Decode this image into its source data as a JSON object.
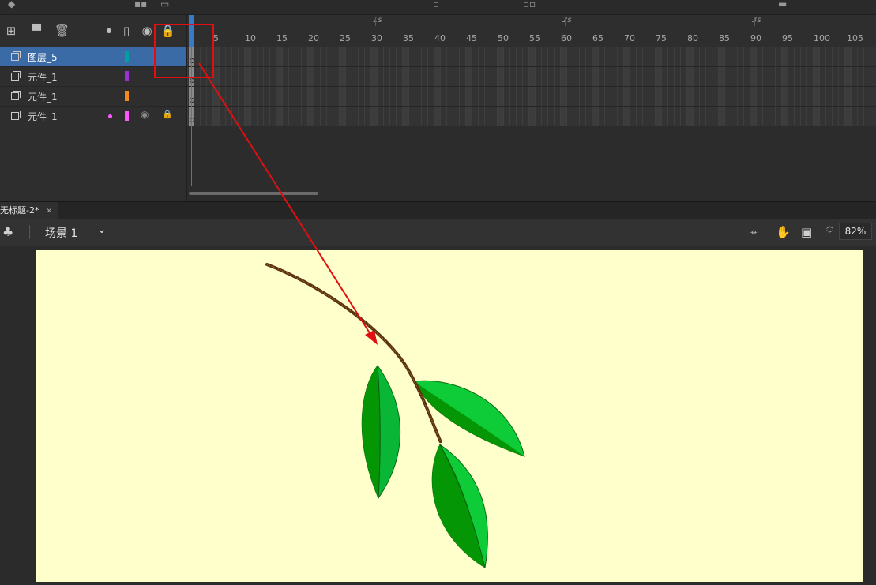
{
  "timeline": {
    "ruler": {
      "seconds": [
        "1s",
        "2s",
        "3s"
      ],
      "frames": [
        "5",
        "10",
        "15",
        "20",
        "25",
        "30",
        "35",
        "40",
        "45",
        "50",
        "55",
        "60",
        "65",
        "70",
        "75",
        "80",
        "85",
        "90",
        "95",
        "100",
        "105"
      ]
    },
    "layers": [
      {
        "name": "图层_5",
        "color": "#00a0a0",
        "selected": true
      },
      {
        "name": "元件_1",
        "color": "#9b30d8",
        "selected": false
      },
      {
        "name": "元件_1",
        "color": "#f08a1c",
        "selected": false
      },
      {
        "name": "元件_1",
        "color": "#ff55ff",
        "selected": false
      }
    ]
  },
  "document": {
    "tab_title": "无标题-2*",
    "close_glyph": "×"
  },
  "scene": {
    "name": "场景 1",
    "zoom": "82%"
  },
  "icons": {
    "add_layer": "new-layer-icon",
    "add_folder": "folder-icon",
    "delete": "trash-icon",
    "outline": "outline-icon",
    "show_hide": "eye-icon",
    "lock": "lock-icon",
    "scene": "club-icon",
    "center": "crosshair-icon",
    "hand": "hand-icon",
    "clip": "clip-icon"
  },
  "colors": {
    "stage_bg": "#ffffcc",
    "selection_blue": "#3b6ba7",
    "playhead_blue": "#3a78c8",
    "annotation_red": "#e01010",
    "leaf_dark": "#049604",
    "leaf_light": "#0ecc38",
    "stem": "#5a3410"
  }
}
